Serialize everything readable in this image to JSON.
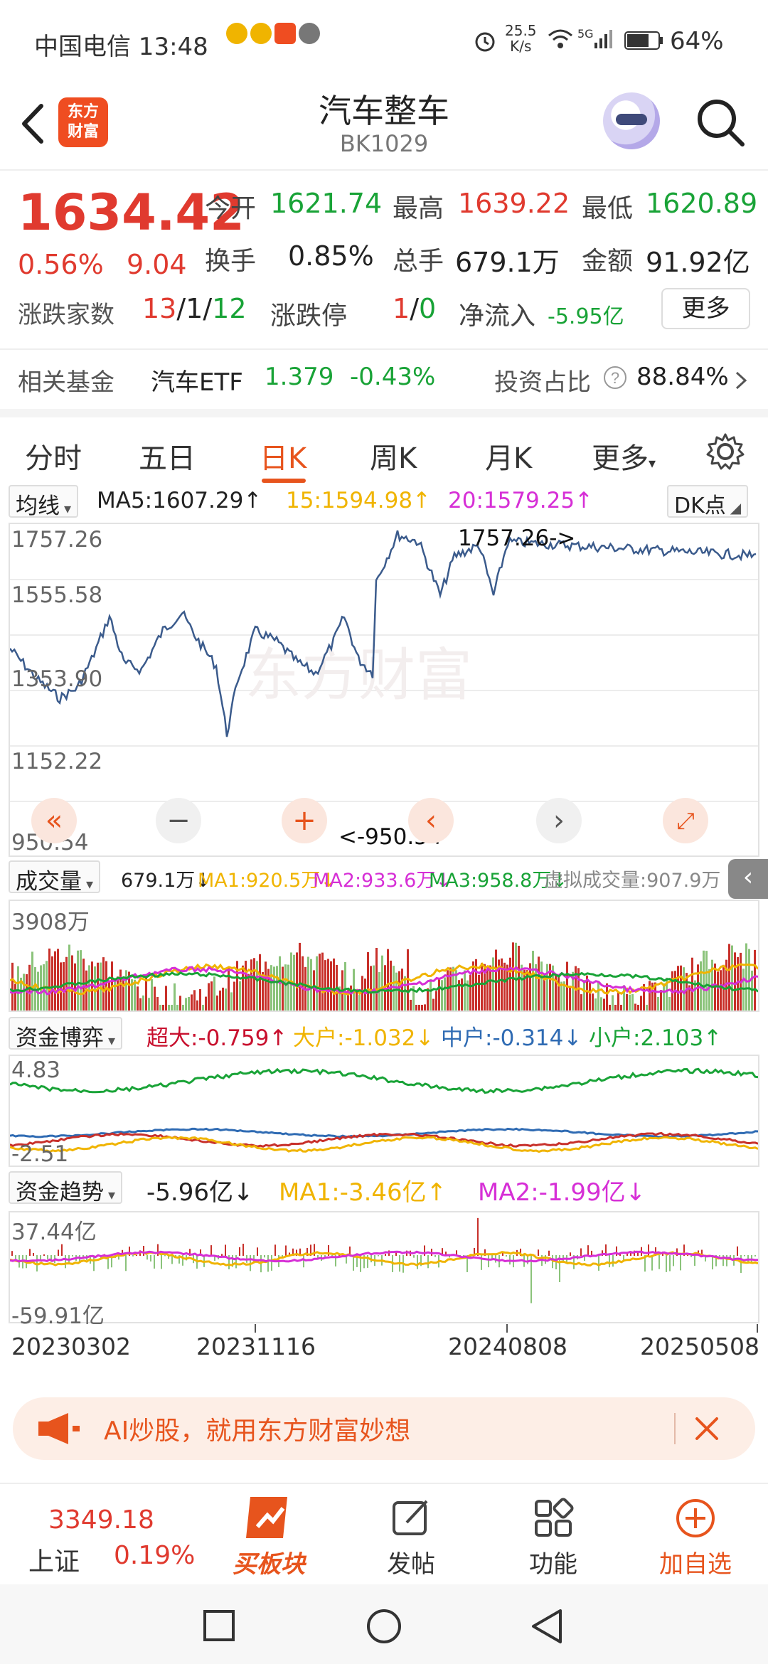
{
  "status_bar": {
    "carrier_time": "中国电信 13:48",
    "net_speed": "25.5",
    "net_unit": "K/s",
    "signal": "5G",
    "battery": "64%"
  },
  "header": {
    "brand_line1": "东方",
    "brand_line2": "财富",
    "title": "汽车整车",
    "code": "BK1029"
  },
  "quote": {
    "price": "1634.42",
    "change_pct": "0.56%",
    "change": "9.04",
    "open_label": "今开",
    "open": "1621.74",
    "high_label": "最高",
    "high": "1639.22",
    "low_label": "最低",
    "low": "1620.89",
    "turnover_label": "换手",
    "turnover": "0.85%",
    "volume_label": "总手",
    "volume": "679.1万",
    "amount_label": "金额",
    "amount": "91.92亿",
    "breadth_label": "涨跌家数",
    "breadth_up": "13",
    "breadth_flat": "1",
    "breadth_down": "12",
    "limit_label": "涨跌停",
    "limit_up": "1",
    "limit_down": "0",
    "inflow_label": "净流入",
    "inflow": "-5.95亿",
    "more": "更多",
    "fund_label": "相关基金",
    "fund_name": "汽车ETF",
    "fund_price": "1.379",
    "fund_change": "-0.43%",
    "invest_label": "投资占比",
    "invest_ratio": "88.84%"
  },
  "tabs": [
    "分时",
    "五日",
    "日K",
    "周K",
    "月K",
    "更多"
  ],
  "active_tab": "日K",
  "ma_row": {
    "type": "均线",
    "ma5": "MA5:1607.29↑",
    "ma15": "15:1594.98↑",
    "ma20": "20:1579.25↑",
    "dk": "DK点"
  },
  "kline": {
    "y_labels": [
      "1757.26",
      "1555.58",
      "1353.90",
      "1152.22",
      "950.54"
    ],
    "max_marker": "1757.26->",
    "min_marker": "<-950.54"
  },
  "volume_row": {
    "type": "成交量",
    "vol": "679.1万↓",
    "ma1": "MA1:920.5万↓",
    "ma2": "MA2:933.6万↓",
    "ma3": "MA3:958.8万↓",
    "virtual": "虚拟成交量:907.9万",
    "y_max": "3908万"
  },
  "flow_row": {
    "type": "资金博弈",
    "super": "超大:-0.759↑",
    "large": "大户:-1.032↓",
    "medium": "中户:-0.314↓",
    "small": "小户:2.103↑",
    "y_max": "4.83",
    "y_min": "-2.51"
  },
  "trend_row": {
    "type": "资金趋势",
    "value": "-5.96亿↓",
    "ma1": "MA1:-3.46亿↑",
    "ma2": "MA2:-1.99亿↓",
    "y_max": "37.44亿",
    "y_min": "-59.91亿"
  },
  "x_axis": [
    "20230302",
    "20231116",
    "20240808",
    "20250508"
  ],
  "banner": {
    "text": "AI炒股，就用东方财富妙想"
  },
  "bottom_bar": {
    "index_value": "3349.18",
    "index_name": "上证",
    "index_change": "0.19%",
    "board": "买板块",
    "post": "发帖",
    "functions": "功能",
    "add": "加自选"
  },
  "colors": {
    "up": "#e03a2f",
    "down": "#19a337",
    "accent": "#e7541d",
    "kline": "#3b5b8c"
  }
}
